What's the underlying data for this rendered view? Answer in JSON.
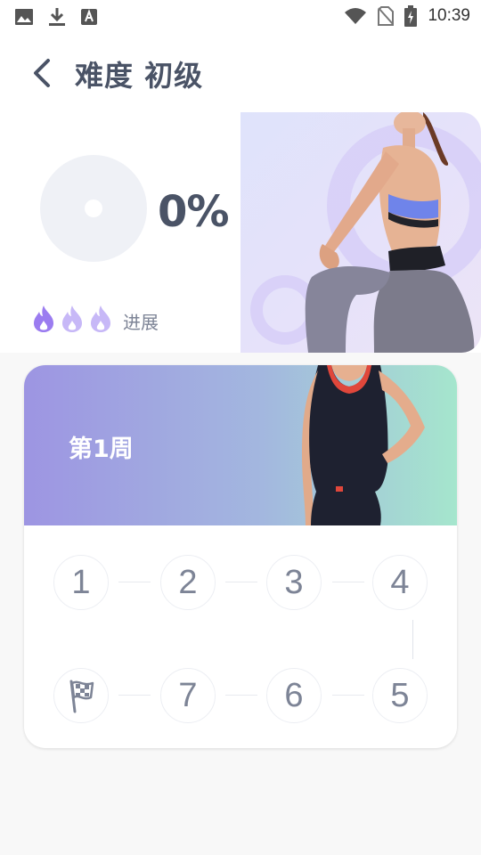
{
  "status_bar": {
    "time": "10:39",
    "left_icons": [
      "image-icon",
      "download-icon",
      "font-icon"
    ],
    "right_icons": [
      "wifi-icon",
      "no-sim-icon",
      "battery-charging-icon"
    ]
  },
  "header": {
    "title": "难度 初级"
  },
  "progress": {
    "percent_text": "0%",
    "percent_value": 0,
    "label": "进展",
    "flames_active": 1,
    "flames_total": 3
  },
  "week_card": {
    "title": "第1周",
    "days_row1": [
      "1",
      "2",
      "3",
      "4"
    ],
    "days_row2": [
      "7",
      "6",
      "5"
    ],
    "finish_icon": "checkered-flag-icon"
  },
  "colors": {
    "text_primary": "#4a5366",
    "text_secondary": "#7d8496",
    "flame_active": "#9b7cf0",
    "flame_inactive": "#c7b8f7",
    "banner_start": "#9d95e2",
    "banner_end": "#a5e6cd"
  }
}
